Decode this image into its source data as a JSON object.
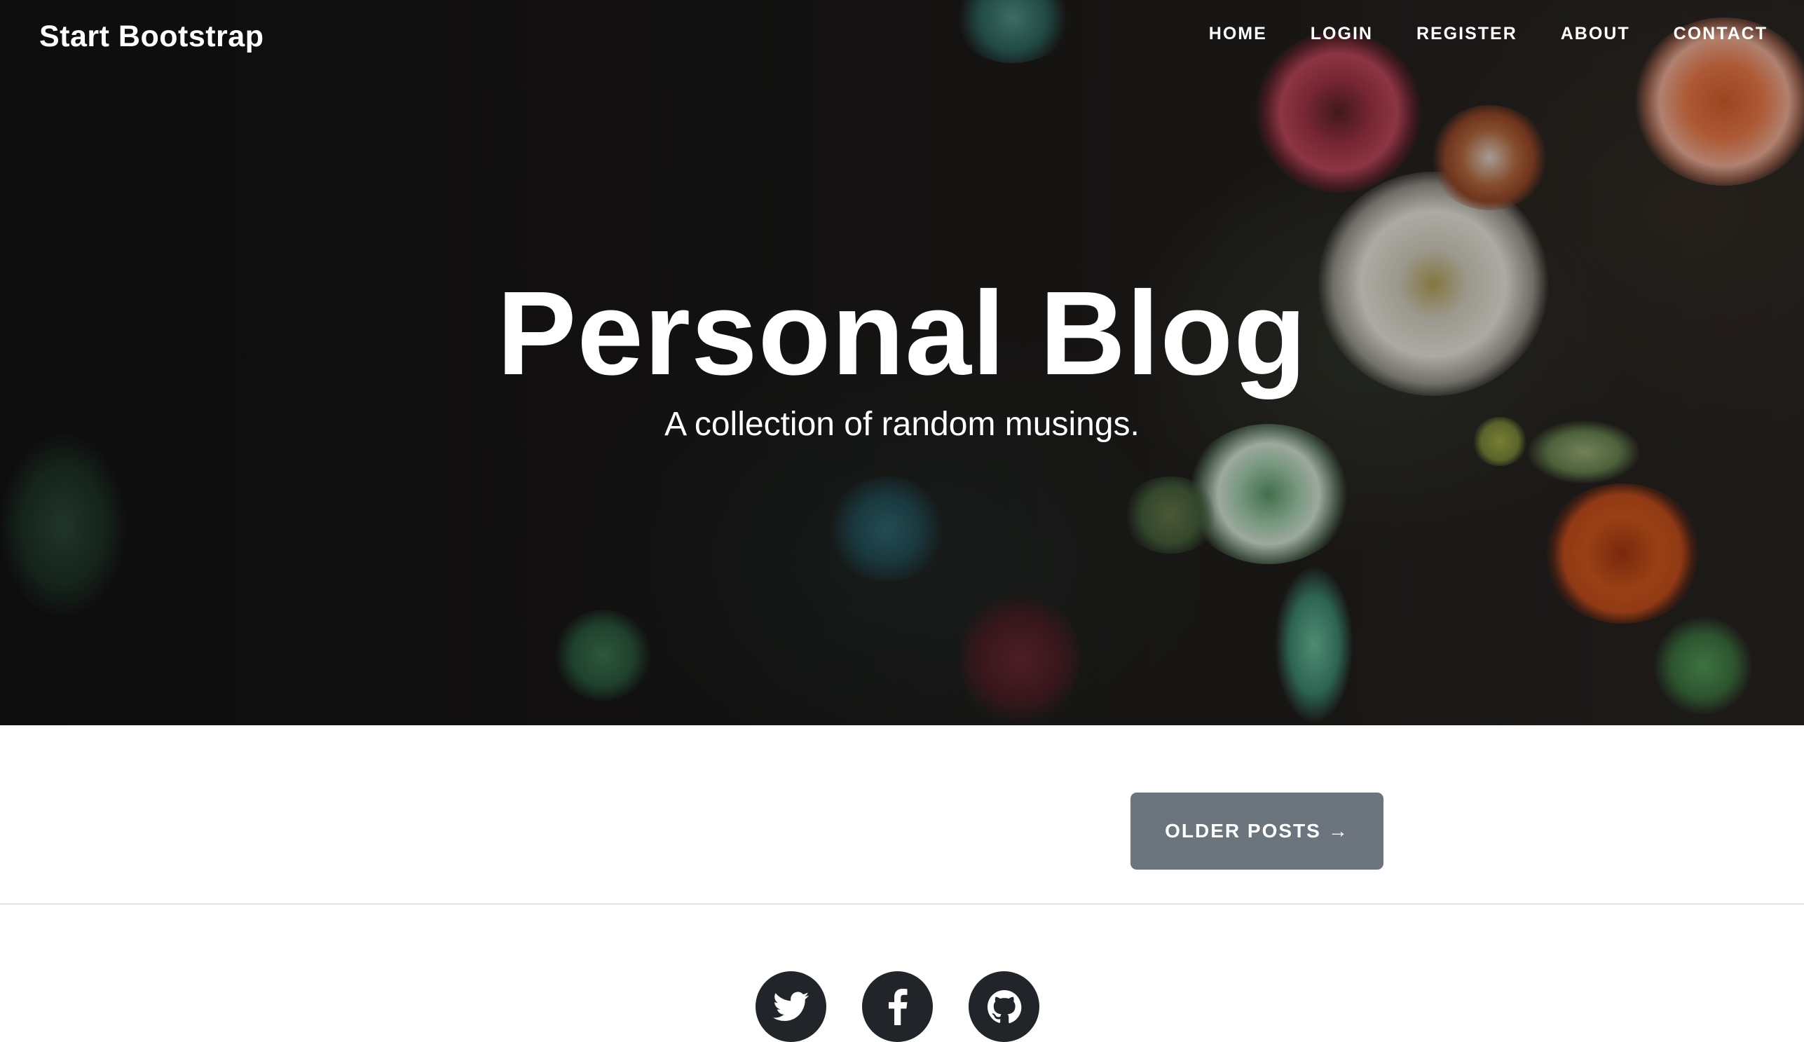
{
  "navbar": {
    "brand": "Start Bootstrap",
    "links": [
      {
        "label": "HOME"
      },
      {
        "label": "LOGIN"
      },
      {
        "label": "REGISTER"
      },
      {
        "label": "ABOUT"
      },
      {
        "label": "CONTACT"
      }
    ]
  },
  "hero": {
    "title": "Personal Blog",
    "subtitle": "A collection of random musings."
  },
  "pager": {
    "older_label": "OLDER POSTS",
    "older_arrow": "→"
  },
  "footer": {
    "social": [
      {
        "icon": "twitter-icon"
      },
      {
        "icon": "facebook-icon"
      },
      {
        "icon": "github-icon"
      }
    ]
  },
  "colors": {
    "button_bg": "#6c757d",
    "social_bg": "#212529",
    "divider": "#dee2e6"
  }
}
